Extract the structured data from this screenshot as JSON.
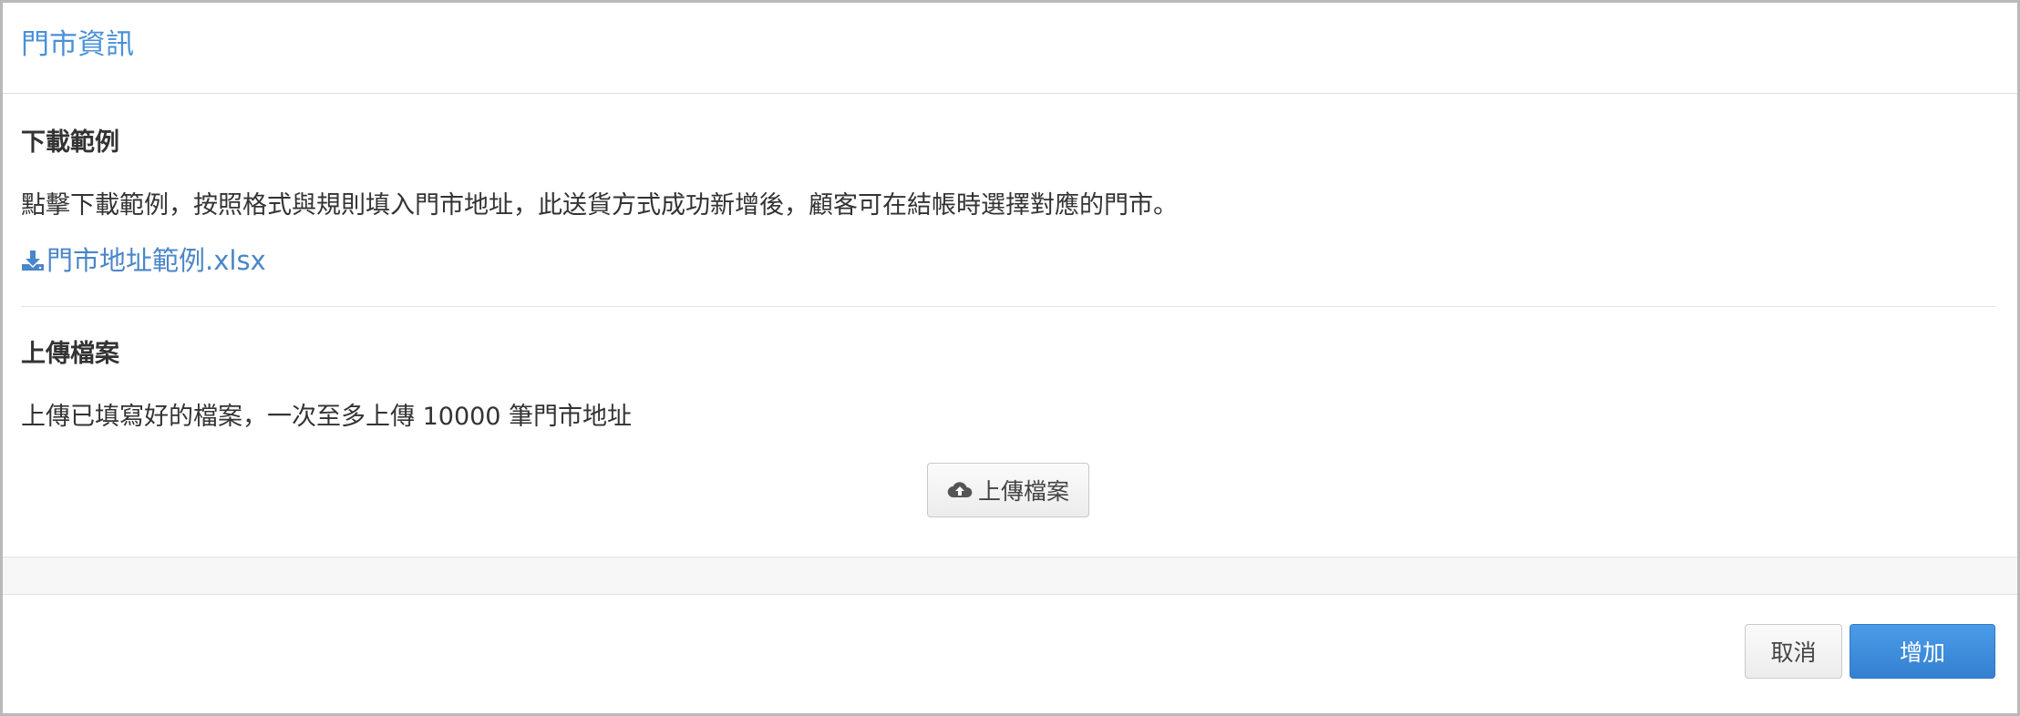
{
  "dialog": {
    "title": "門市資訊"
  },
  "download_section": {
    "heading": "下載範例",
    "description": "點擊下載範例，按照格式與規則填入門市地址，此送貨方式成功新增後，顧客可在結帳時選擇對應的門市。",
    "link_label": "門市地址範例.xlsx",
    "link_icon": "download-icon"
  },
  "upload_section": {
    "heading": "上傳檔案",
    "description": "上傳已填寫好的檔案，一次至多上傳 10000 筆門市地址",
    "button_label": "上傳檔案",
    "button_icon": "cloud-upload-icon"
  },
  "footer": {
    "cancel_label": "取消",
    "add_label": "增加"
  },
  "colors": {
    "title": "#4a90d9",
    "link": "#4a86c8",
    "primary_button": "#3b8ad9"
  }
}
